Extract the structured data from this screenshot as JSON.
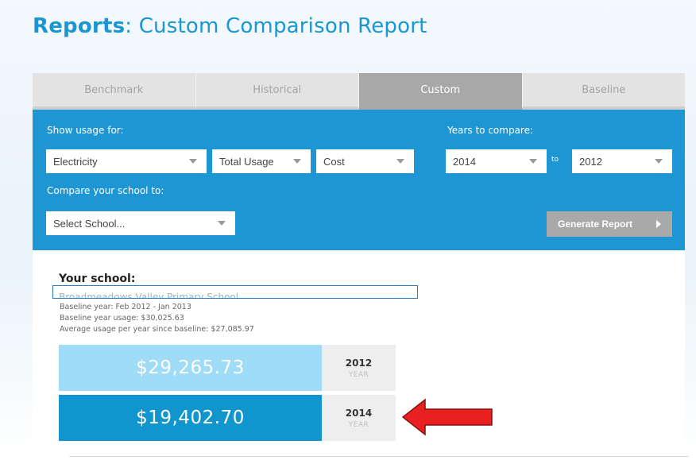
{
  "header": {
    "title_strong": "Reports",
    "title_rest": ": Custom Comparison Report"
  },
  "tabs": [
    {
      "label": "Benchmark",
      "active": false
    },
    {
      "label": "Historical",
      "active": false
    },
    {
      "label": "Custom",
      "active": true
    },
    {
      "label": "Baseline",
      "active": false
    }
  ],
  "controls": {
    "show_usage_label": "Show usage for:",
    "utility_select": "Electricity",
    "measure_select": "Total Usage",
    "unit_select": "Cost",
    "years_label": "Years to compare:",
    "year_from": "2014",
    "to_label": "to",
    "year_to": "2012",
    "compare_label": "Compare your school to:",
    "school_select_placeholder": "Select School...",
    "generate_button": "Generate Report"
  },
  "results": {
    "your_school_label": "Your school:",
    "school_name": "Broadmeadows Valley Primary School",
    "baseline_year": "Baseline year: Feb 2012 - Jan 2013",
    "baseline_usage": "Baseline year usage: $30,025.63",
    "average_usage": "Average usage per year since baseline: $27,085.97",
    "rows": [
      {
        "value": "$29,265.73",
        "year": "2012",
        "year_label": "YEAR",
        "color": "#9fdcf7"
      },
      {
        "value": "$19,402.70",
        "year": "2014",
        "year_label": "YEAR",
        "color": "#1195cf"
      }
    ]
  },
  "colors": {
    "brand_blue": "#1d96d3",
    "annotation_arrow": "#e8201f"
  },
  "annotation": {
    "icon": "left-arrow-icon"
  }
}
